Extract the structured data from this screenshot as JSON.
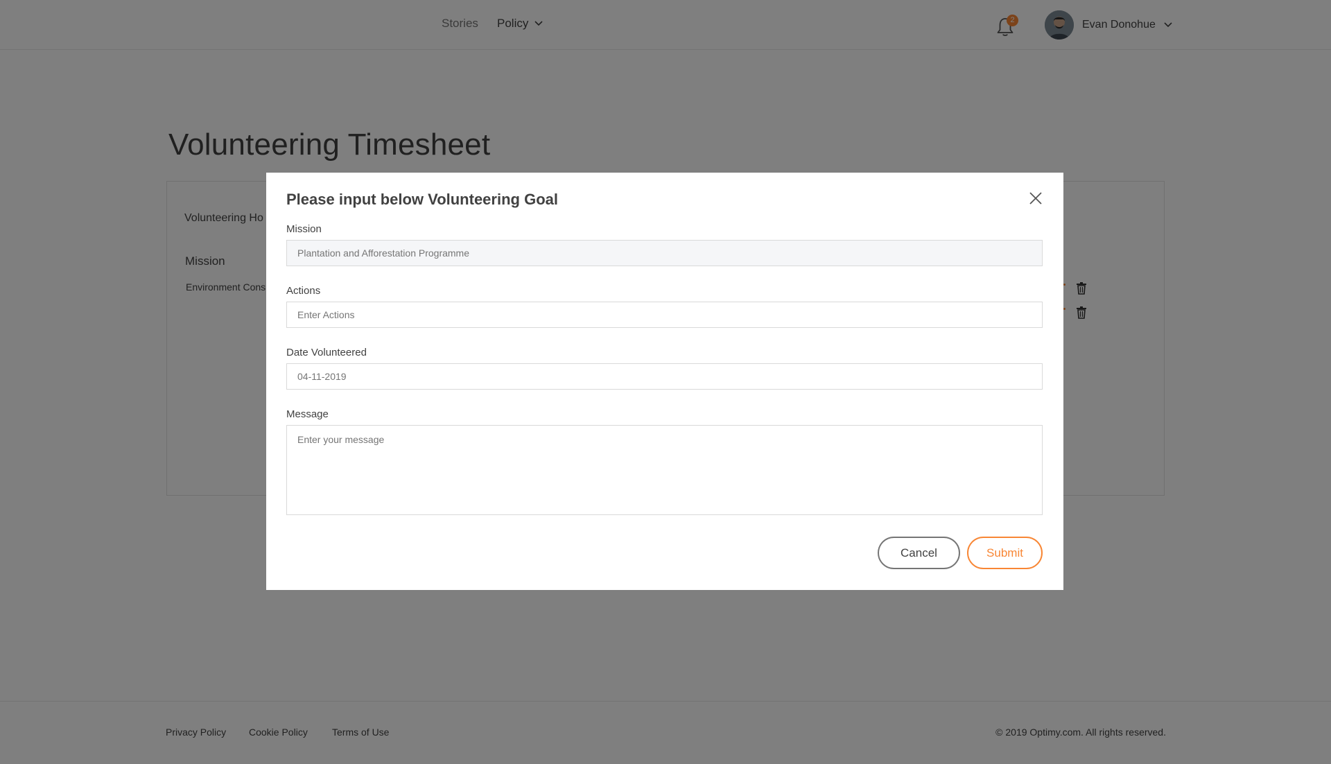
{
  "header": {
    "nav": [
      {
        "label": "Stories"
      },
      {
        "label": "Policy"
      }
    ],
    "notifications": {
      "count": "2",
      "icon": "bell-icon"
    },
    "user": {
      "name": "Evan Donohue"
    }
  },
  "main": {
    "title": "Volunteering Timesheet",
    "card": {
      "tab_label": "Volunteering Ho",
      "column_mission": "Mission",
      "row_text": "Environment Cons"
    }
  },
  "modal": {
    "title": "Please input below Volunteering Goal",
    "fields": {
      "mission": {
        "label": "Mission",
        "value": "Plantation and Afforestation Programme"
      },
      "actions": {
        "label": "Actions",
        "placeholder": "Enter Actions"
      },
      "date": {
        "label": "Date Volunteered",
        "value": "04-11-2019"
      },
      "message": {
        "label": "Message",
        "placeholder": "Enter your message"
      }
    },
    "buttons": {
      "cancel": "Cancel",
      "submit": "Submit"
    }
  },
  "footer": {
    "links": [
      {
        "label": "Privacy Policy"
      },
      {
        "label": "Cookie Policy"
      },
      {
        "label": "Terms of Use"
      }
    ],
    "copyright": "© 2019 Optimy.com. All rights reserved."
  },
  "colors": {
    "accent": "#f88634",
    "overlay": "rgba(0,0,0,0.5)",
    "text": "#414141"
  }
}
